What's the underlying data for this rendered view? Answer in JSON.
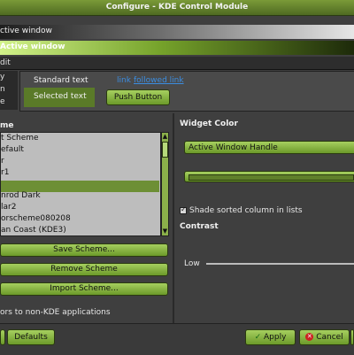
{
  "window": {
    "title": "Configure - KDE Control Module"
  },
  "preview": {
    "inactive_window_label": "ctive window",
    "active_window_label": "Active window",
    "menubar_label": "dit",
    "side_items": [
      "y",
      "n",
      "e"
    ],
    "standard_text": "Standard text",
    "link_text": "link",
    "followed_link": "followed link",
    "selected_text": "Selected text",
    "push_button": "Push Button"
  },
  "scheme_panel": {
    "header": "me",
    "items": [
      "t Scheme",
      "efault",
      "r",
      "r1",
      "",
      "nrod Dark",
      "lar2",
      "orscheme080208",
      "an Coast (KDE3)"
    ],
    "selected_index": 4,
    "save_button": "Save Scheme...",
    "remove_button": "Remove Scheme",
    "import_button": "Import Scheme...",
    "apply_colors_label": "ors to non-KDE applications"
  },
  "widget_color": {
    "header": "Widget Color",
    "selected": "Active Window Handle",
    "shade_sorted_label": "Shade sorted column in lists",
    "shade_sorted_checked": true,
    "contrast_header": "Contrast",
    "low_label": "Low"
  },
  "footer": {
    "defaults_button": "Defaults",
    "apply_button": "Apply",
    "cancel_button": "Cancel"
  },
  "colors": {
    "accent": "#8bb04a",
    "link": "#3b8de0",
    "visited_link": "#3b8de0"
  }
}
